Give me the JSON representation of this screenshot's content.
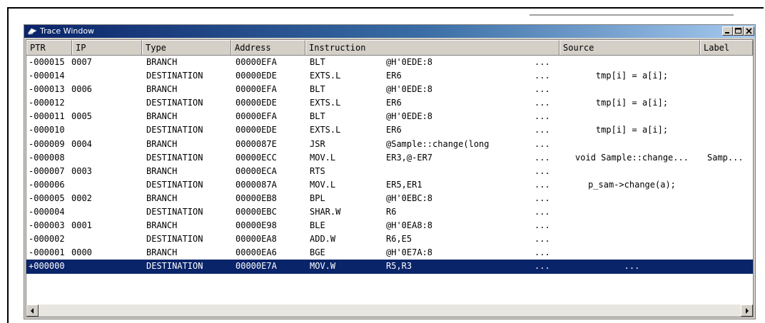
{
  "window": {
    "title": "Trace Window"
  },
  "columns": {
    "ptr": "PTR",
    "ip": "IP",
    "type": "Type",
    "address": "Address",
    "instruction": "Instruction",
    "source": "Source",
    "label": "Label"
  },
  "rows": [
    {
      "ptr": "-000015",
      "ip": "0007",
      "type": "BRANCH",
      "address": "00000EFA",
      "mnemonic": "BLT",
      "operands": "@H'0EDE:8",
      "ellipsis": "...",
      "source": "",
      "label": ""
    },
    {
      "ptr": "-000014",
      "ip": "",
      "type": "DESTINATION",
      "address": "00000EDE",
      "mnemonic": "EXTS.L",
      "operands": "ER6",
      "ellipsis": "...",
      "source": "tmp[i] = a[i];",
      "label": ""
    },
    {
      "ptr": "-000013",
      "ip": "0006",
      "type": "BRANCH",
      "address": "00000EFA",
      "mnemonic": "BLT",
      "operands": "@H'0EDE:8",
      "ellipsis": "...",
      "source": "",
      "label": ""
    },
    {
      "ptr": "-000012",
      "ip": "",
      "type": "DESTINATION",
      "address": "00000EDE",
      "mnemonic": "EXTS.L",
      "operands": "ER6",
      "ellipsis": "...",
      "source": "tmp[i] = a[i];",
      "label": ""
    },
    {
      "ptr": "-000011",
      "ip": "0005",
      "type": "BRANCH",
      "address": "00000EFA",
      "mnemonic": "BLT",
      "operands": "@H'0EDE:8",
      "ellipsis": "...",
      "source": "",
      "label": ""
    },
    {
      "ptr": "-000010",
      "ip": "",
      "type": "DESTINATION",
      "address": "00000EDE",
      "mnemonic": "EXTS.L",
      "operands": "ER6",
      "ellipsis": "...",
      "source": "tmp[i] = a[i];",
      "label": ""
    },
    {
      "ptr": "-000009",
      "ip": "0004",
      "type": "BRANCH",
      "address": "0000087E",
      "mnemonic": "JSR",
      "operands": "@Sample::change(long",
      "ellipsis": "...",
      "source": "",
      "label": ""
    },
    {
      "ptr": "-000008",
      "ip": "",
      "type": "DESTINATION",
      "address": "00000ECC",
      "mnemonic": "MOV.L",
      "operands": "ER3,@-ER7",
      "ellipsis": "...",
      "source": "void Sample::change...",
      "label": "Samp..."
    },
    {
      "ptr": "-000007",
      "ip": "0003",
      "type": "BRANCH",
      "address": "00000ECA",
      "mnemonic": "RTS",
      "operands": "",
      "ellipsis": "...",
      "source": "",
      "label": ""
    },
    {
      "ptr": "-000006",
      "ip": "",
      "type": "DESTINATION",
      "address": "0000087A",
      "mnemonic": "MOV.L",
      "operands": "ER5,ER1",
      "ellipsis": "...",
      "source": "p_sam->change(a);",
      "label": ""
    },
    {
      "ptr": "-000005",
      "ip": "0002",
      "type": "BRANCH",
      "address": "00000EB8",
      "mnemonic": "BPL",
      "operands": "@H'0EBC:8",
      "ellipsis": "...",
      "source": "",
      "label": ""
    },
    {
      "ptr": "-000004",
      "ip": "",
      "type": "DESTINATION",
      "address": "00000EBC",
      "mnemonic": "SHAR.W",
      "operands": "R6",
      "ellipsis": "...",
      "source": "",
      "label": ""
    },
    {
      "ptr": "-000003",
      "ip": "0001",
      "type": "BRANCH",
      "address": "00000E98",
      "mnemonic": "BLE",
      "operands": "@H'0EA8:8",
      "ellipsis": "...",
      "source": "",
      "label": ""
    },
    {
      "ptr": "-000002",
      "ip": "",
      "type": "DESTINATION",
      "address": "00000EA8",
      "mnemonic": "ADD.W",
      "operands": "R6,E5",
      "ellipsis": "...",
      "source": "",
      "label": ""
    },
    {
      "ptr": "-000001",
      "ip": "0000",
      "type": "BRANCH",
      "address": "00000EA6",
      "mnemonic": "BGE",
      "operands": "@H'0E7A:8",
      "ellipsis": "...",
      "source": "",
      "label": ""
    },
    {
      "ptr": "+000000",
      "ip": "",
      "type": "DESTINATION",
      "address": "00000E7A",
      "mnemonic": "MOV.W",
      "operands": "R5,R3",
      "ellipsis": "...",
      "source": "...",
      "label": "",
      "selected": true
    }
  ],
  "colors": {
    "selection": "#0a246a",
    "title_start": "#0a246a",
    "title_end": "#a6caf0"
  }
}
